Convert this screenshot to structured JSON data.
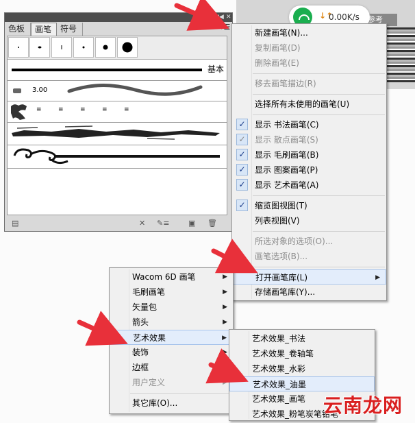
{
  "background": {
    "tab_label": "描参考"
  },
  "speed_widget": {
    "arrows": "↓↑",
    "value": "0.00K/s"
  },
  "panel": {
    "tabs": [
      "色板",
      "画笔",
      "符号"
    ],
    "basic_label": "基本",
    "calligraphic_value": "3.00"
  },
  "main_menu": {
    "items": [
      {
        "label": "新建画笔(N)...",
        "enabled": true
      },
      {
        "label": "复制画笔(D)",
        "enabled": false
      },
      {
        "label": "删除画笔(E)",
        "enabled": false
      },
      {
        "label": "移去画笔描边(R)",
        "enabled": false
      },
      {
        "label": "选择所有未使用的画笔(U)",
        "enabled": true
      },
      {
        "label": "显示 书法画笔(C)",
        "enabled": true,
        "checked": true
      },
      {
        "label": "显示 散点画笔(S)",
        "enabled": false,
        "checked": true
      },
      {
        "label": "显示 毛刷画笔(B)",
        "enabled": true,
        "checked": true
      },
      {
        "label": "显示 图案画笔(P)",
        "enabled": true,
        "checked": true
      },
      {
        "label": "显示 艺术画笔(A)",
        "enabled": true,
        "checked": true
      },
      {
        "label": "缩览图视图(T)",
        "enabled": true,
        "checked": true
      },
      {
        "label": "列表视图(V)",
        "enabled": true
      },
      {
        "label": "所选对象的选项(O)...",
        "enabled": false
      },
      {
        "label": "画笔选项(B)...",
        "enabled": false
      },
      {
        "label": "打开画笔库(L)",
        "enabled": true,
        "submenu": true,
        "highlighted": true
      },
      {
        "label": "存储画笔库(Y)...",
        "enabled": true
      }
    ]
  },
  "library_menu": {
    "items": [
      {
        "label": "Wacom 6D 画笔",
        "submenu": true
      },
      {
        "label": "毛刷画笔",
        "submenu": true
      },
      {
        "label": "矢量包",
        "submenu": true
      },
      {
        "label": "箭头",
        "submenu": true
      },
      {
        "label": "艺术效果",
        "submenu": true,
        "highlighted": true
      },
      {
        "label": "装饰",
        "submenu": true
      },
      {
        "label": "边框",
        "submenu": true
      },
      {
        "label": "用户定义",
        "submenu": true,
        "enabled": false
      },
      {
        "label": "其它库(O)..."
      }
    ]
  },
  "art_menu": {
    "items": [
      {
        "label": "艺术效果_书法"
      },
      {
        "label": "艺术效果_卷轴笔"
      },
      {
        "label": "艺术效果_水彩"
      },
      {
        "label": "艺术效果_油墨",
        "highlighted": true
      },
      {
        "label": "艺术效果_画笔"
      },
      {
        "label": "艺术效果_粉笔炭笔铅笔"
      }
    ]
  },
  "watermark": "云南龙网",
  "colors": {
    "arrow_red": "#e8303a",
    "check_blue": "#1b3c8a",
    "highlight": "#e3edfb"
  }
}
